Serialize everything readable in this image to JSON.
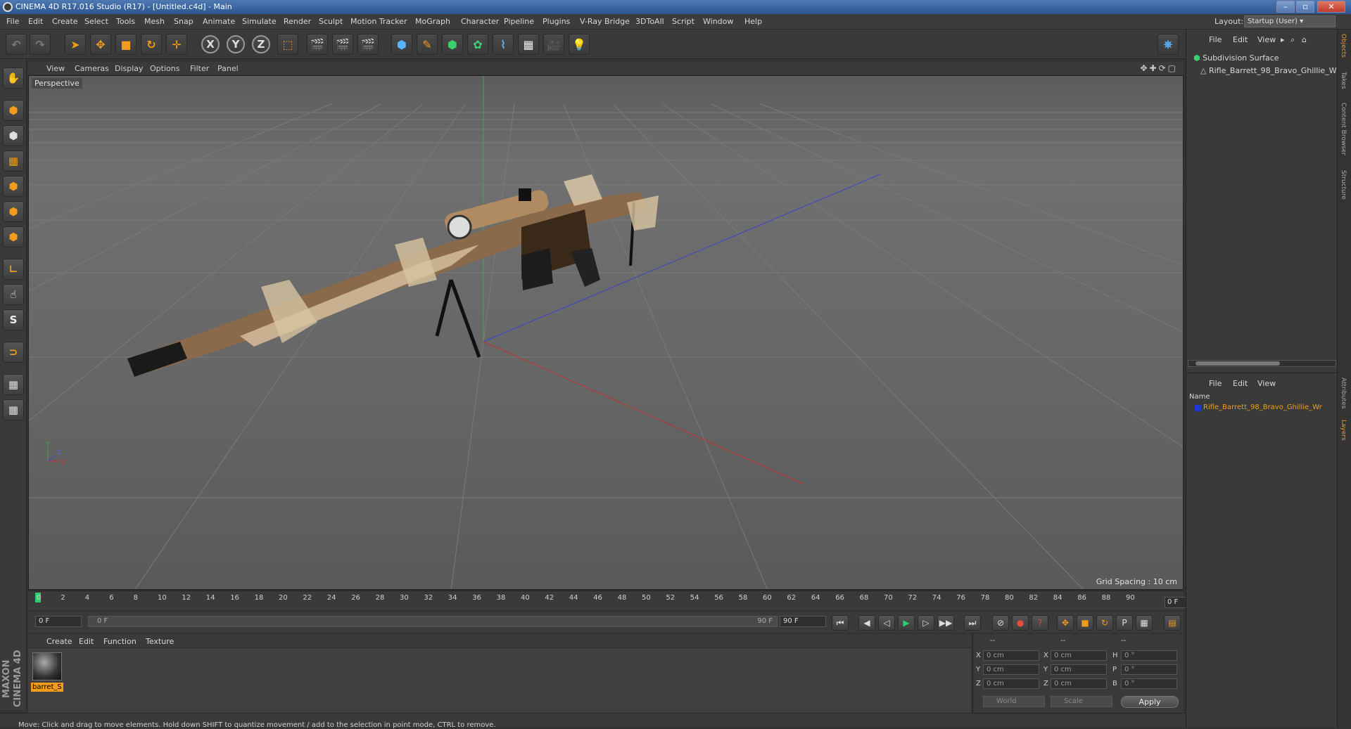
{
  "window": {
    "title": "CINEMA 4D R17.016 Studio (R17) - [Untitled.c4d] - Main",
    "buttons": [
      "–",
      "▫",
      "✕"
    ]
  },
  "menu": [
    "File",
    "Edit",
    "Create",
    "Select",
    "Tools",
    "Mesh",
    "Snap",
    "Animate",
    "Simulate",
    "Render",
    "Sculpt",
    "Motion Tracker",
    "MoGraph",
    "Character",
    "Pipeline",
    "Plugins",
    "V-Ray Bridge",
    "3DToAll",
    "Script",
    "Window",
    "Help"
  ],
  "layout": {
    "label": "Layout:",
    "value": "Startup (User)"
  },
  "toolbar": {
    "icons": [
      "undo-icon",
      "redo-icon",
      "select-pointer-icon",
      "move-icon",
      "scale-icon",
      "rotate-icon",
      "live-select-icon",
      "x-axis-icon",
      "y-axis-icon",
      "z-axis-icon",
      "coordinate-system-icon",
      "render-view-icon",
      "render-picture-viewer-icon",
      "edit-render-settings-icon",
      "cube-icon",
      "pen-icon",
      "subdivision-icon",
      "array-icon",
      "deformer-icon",
      "floor-icon",
      "camera-icon",
      "light-icon"
    ],
    "glyphs": [
      "↶",
      "↷",
      "➤",
      "✥",
      "■",
      "↻",
      "✛",
      "X",
      "Y",
      "Z",
      "⬚",
      "🎬",
      "🎬",
      "🎬",
      "⬢",
      "✎",
      "⬢",
      "✿",
      "⌇",
      "▦",
      "🎥",
      "💡"
    ],
    "python_icon": "python-icon"
  },
  "left_tools": [
    "make-editable-icon",
    "model-mode-icon",
    "texture-mode-icon",
    "workplane-icon",
    "points-mode-icon",
    "edges-mode-icon",
    "polygons-mode-icon",
    "axis-mode-icon",
    "tweak-icon",
    "snap-icon",
    "magnet-icon",
    "enable-snap-icon",
    "quantize-icon"
  ],
  "left_glyphs": [
    "✋",
    "⬢",
    "⬢",
    "▦",
    "⬢",
    "⬢",
    "⬢",
    "∟",
    "☝",
    "S",
    "⊃",
    "▦",
    "▦"
  ],
  "branding": "MAXON CINEMA 4D",
  "viewport": {
    "menu": [
      "View",
      "Cameras",
      "Display",
      "Options",
      "Filter",
      "Panel"
    ],
    "nav_glyphs": "✥✚⟳▢",
    "label": "Perspective",
    "grid_spacing": "Grid Spacing : 10 cm",
    "axis_labels": {
      "y": "Y",
      "x": "X",
      "z": "Z"
    }
  },
  "timeline": {
    "ticks": [
      "0",
      "2",
      "4",
      "6",
      "8",
      "10",
      "12",
      "14",
      "16",
      "18",
      "20",
      "22",
      "24",
      "26",
      "28",
      "30",
      "32",
      "34",
      "36",
      "38",
      "40",
      "42",
      "44",
      "46",
      "48",
      "50",
      "52",
      "54",
      "56",
      "58",
      "60",
      "62",
      "64",
      "66",
      "68",
      "70",
      "72",
      "74",
      "76",
      "78",
      "80",
      "82",
      "84",
      "86",
      "88",
      "90"
    ],
    "current_frame": "0 F"
  },
  "playback": {
    "start": "0 F",
    "range_start": "0 F",
    "range_end": "90 F",
    "end": "90 F",
    "buttons": [
      "⏮",
      "◀",
      "◁",
      "▶",
      "▷",
      "▶▶",
      "⏭"
    ]
  },
  "anim_buttons": [
    "⊘",
    "●",
    "?",
    "✥",
    "■",
    "↻",
    "P",
    "▦",
    "▤"
  ],
  "material_manager": {
    "menu": [
      "Create",
      "Edit",
      "Function",
      "Texture"
    ],
    "material_name": "barret_S"
  },
  "coordinates": {
    "header": [
      "--",
      "--",
      "--"
    ],
    "rows": [
      {
        "axis": "X",
        "pos": "0 cm",
        "axis2": "X",
        "size": "0 cm",
        "rot_label": "H",
        "rot": "0 °"
      },
      {
        "axis": "Y",
        "pos": "0 cm",
        "axis2": "Y",
        "size": "0 cm",
        "rot_label": "P",
        "rot": "0 °"
      },
      {
        "axis": "Z",
        "pos": "0 cm",
        "axis2": "Z",
        "size": "0 cm",
        "rot_label": "B",
        "rot": "0 °"
      }
    ],
    "space": "World",
    "mode": "Scale",
    "apply": "Apply"
  },
  "status": "Move: Click and drag to move elements. Hold down SHIFT to quantize movement / add to the selection in point mode, CTRL to remove.",
  "objects_panel": {
    "menu": [
      "File",
      "Edit",
      "View"
    ],
    "items": [
      "Subdivision Surface",
      "Rifle_Barrett_98_Bravo_Ghillie_W"
    ]
  },
  "layers_panel": {
    "menu": [
      "File",
      "Edit",
      "View"
    ],
    "column": "Name",
    "layer": "Rifle_Barrett_98_Bravo_Ghillie_Wr",
    "layer_color": "#2038d0"
  },
  "side_tabs": [
    "Objects",
    "Takes",
    "Content Browser",
    "Structure",
    "Attributes",
    "Layers"
  ],
  "colors": {
    "accent": "#f39c1b",
    "play": "#2ecc71",
    "record": "#e74c3c",
    "titlebar": "#3a66a5"
  }
}
